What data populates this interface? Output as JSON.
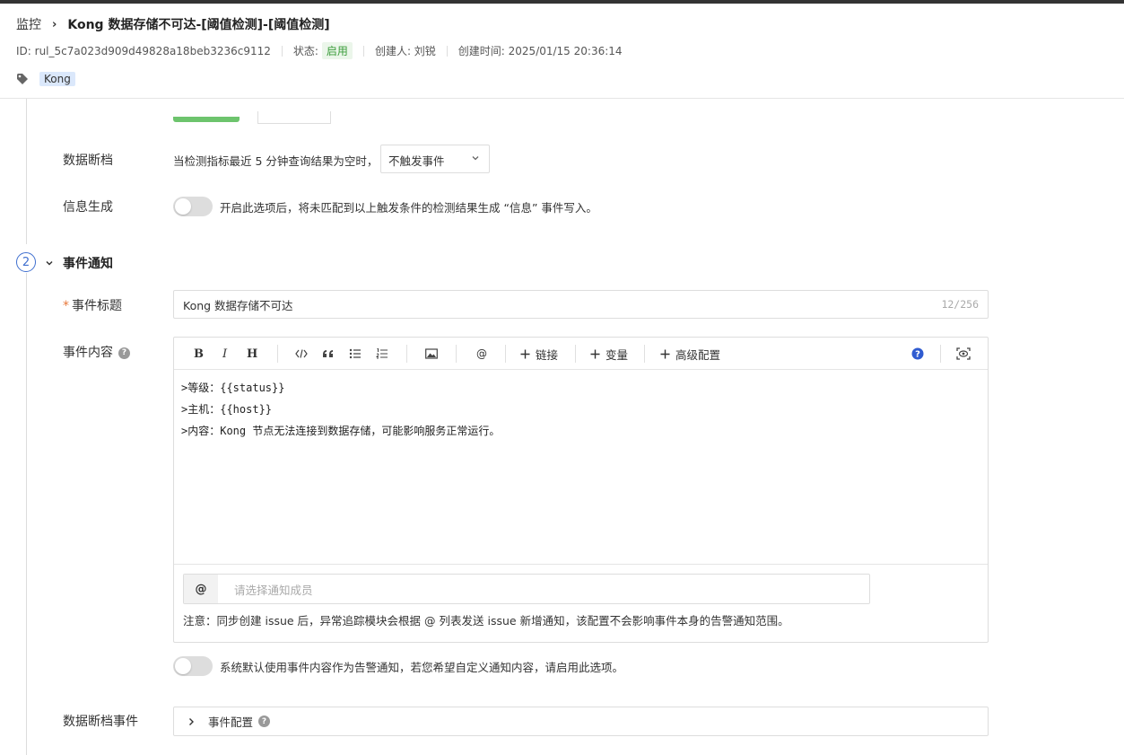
{
  "breadcrumb": {
    "root": "监控",
    "current": "Kong 数据存储不可达-[阈值检测]-[阈值检测]"
  },
  "meta": {
    "id": "ID: rul_5c7a023d909d49828a18beb3236c9112",
    "status_label": "状态:",
    "status_value": "启用",
    "creator": "创建人: 刘锐",
    "created_time": "创建时间: 2025/01/15 20:36:14"
  },
  "tags": [
    "Kong"
  ],
  "data_gap": {
    "label": "数据断档",
    "text": "当检测指标最近 5 分钟查询结果为空时，",
    "select_value": "不触发事件"
  },
  "info_gen": {
    "label": "信息生成",
    "text": "开启此选项后，将未匹配到以上触发条件的检测结果生成 “信息” 事件写入。"
  },
  "section2": {
    "number": "2",
    "title": "事件通知"
  },
  "event_title": {
    "required_mark": "*",
    "label": "事件标题",
    "value": "Kong  数据存储不可达",
    "counter": "12/256"
  },
  "event_content": {
    "label": "事件内容",
    "toolbar": {
      "bold": "B",
      "italic": "I",
      "heading": "H",
      "at": "@",
      "link": "链接",
      "variable": "变量",
      "advanced": "高级配置"
    },
    "lines": [
      ">等级：{{status}}",
      ">主机：{{host}}",
      ">内容：Kong 节点无法连接到数据存储，可能影响服务正常运行。"
    ],
    "mention_at": "@",
    "mention_placeholder": "请选择通知成员",
    "note": "注意：同步创建 issue 后，异常追踪模块会根据 @ 列表发送 issue 新增通知，该配置不会影响事件本身的告警通知范围。"
  },
  "custom_notify": {
    "text": "系统默认使用事件内容作为告警通知，若您希望自定义通知内容，请启用此选项。"
  },
  "gap_event": {
    "label": "数据断档事件",
    "collapse_label": "事件配置"
  },
  "colors": {
    "accent_blue": "#3f6fcf",
    "status_green": "#3a9c3a",
    "tag_bg": "#dbe8fb",
    "required": "#e8783a"
  }
}
